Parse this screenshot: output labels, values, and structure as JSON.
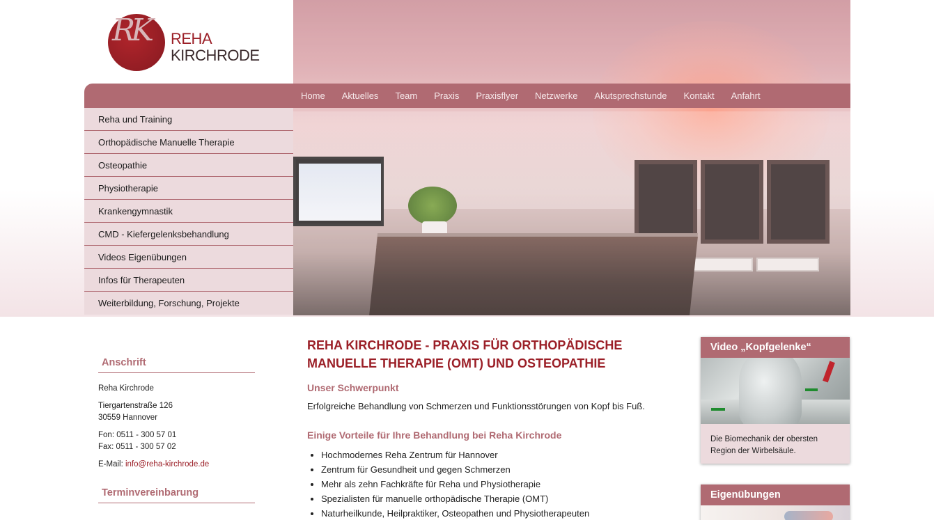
{
  "brand": {
    "monogram_left": "R",
    "monogram_right": "K",
    "name_line1": "REHA",
    "name_line2": "KIRCHRODE",
    "color": "#9b1f27"
  },
  "nav": {
    "items": [
      "Home",
      "Aktuelles",
      "Team",
      "Praxis",
      "Praxisflyer",
      "Netzwerke",
      "Akutsprechstunde",
      "Kontakt",
      "Anfahrt"
    ],
    "bar_color": "#b06a72"
  },
  "sidemenu": {
    "items": [
      "Reha und Training",
      "Orthopädische Manuelle Therapie",
      "Osteopathie",
      "Physiotherapie",
      "Krankengymnastik",
      "CMD - Kiefergelenksbehandlung",
      "Videos Eigenübungen",
      "Infos für Therapeuten",
      "Weiterbildung, Forschung, Projekte"
    ]
  },
  "address": {
    "heading": "Anschrift",
    "name": "Reha Kirchrode",
    "street": "Tiergartenstraße 126",
    "city": "30559 Hannover",
    "phone": "Fon: 0511 - 300 57 01",
    "fax": "Fax: 0511 - 300 57 02",
    "email_label": "E-Mail: ",
    "email": "info@reha-kirchrode.de",
    "appointment_heading": "Terminvereinbarung"
  },
  "main": {
    "title": "REHA KIRCHRODE - PRAXIS FÜR ORTHOPÄDISCHE MANUELLE THERAPIE (OMT) UND OSTEOPATHIE",
    "focus_heading": "Unser Schwerpunkt",
    "focus_text": "Erfolgreiche Behandlung von Schmerzen und Funktionsstörungen von Kopf bis Fuß.",
    "advantages_heading": "Einige Vorteile für Ihre Behandlung bei Reha Kirchrode",
    "advantages": [
      "Hochmodernes Reha Zentrum für Hannover",
      "Zentrum für Gesundheit und gegen Schmerzen",
      "Mehr als zehn Fachkräfte für Reha und Physiotherapie",
      "Spezialisten für manuelle orthopädische Therapie (OMT)",
      "Naturheilkunde, Heilpraktiker, Osteopathen und Physiotherapeuten"
    ]
  },
  "widgets": {
    "video": {
      "title": "Video „Kopfgelenke“",
      "caption": "Die Biomechanik der obersten Region der Wirbelsäule."
    },
    "exercises": {
      "title": "Eigenübungen"
    }
  }
}
